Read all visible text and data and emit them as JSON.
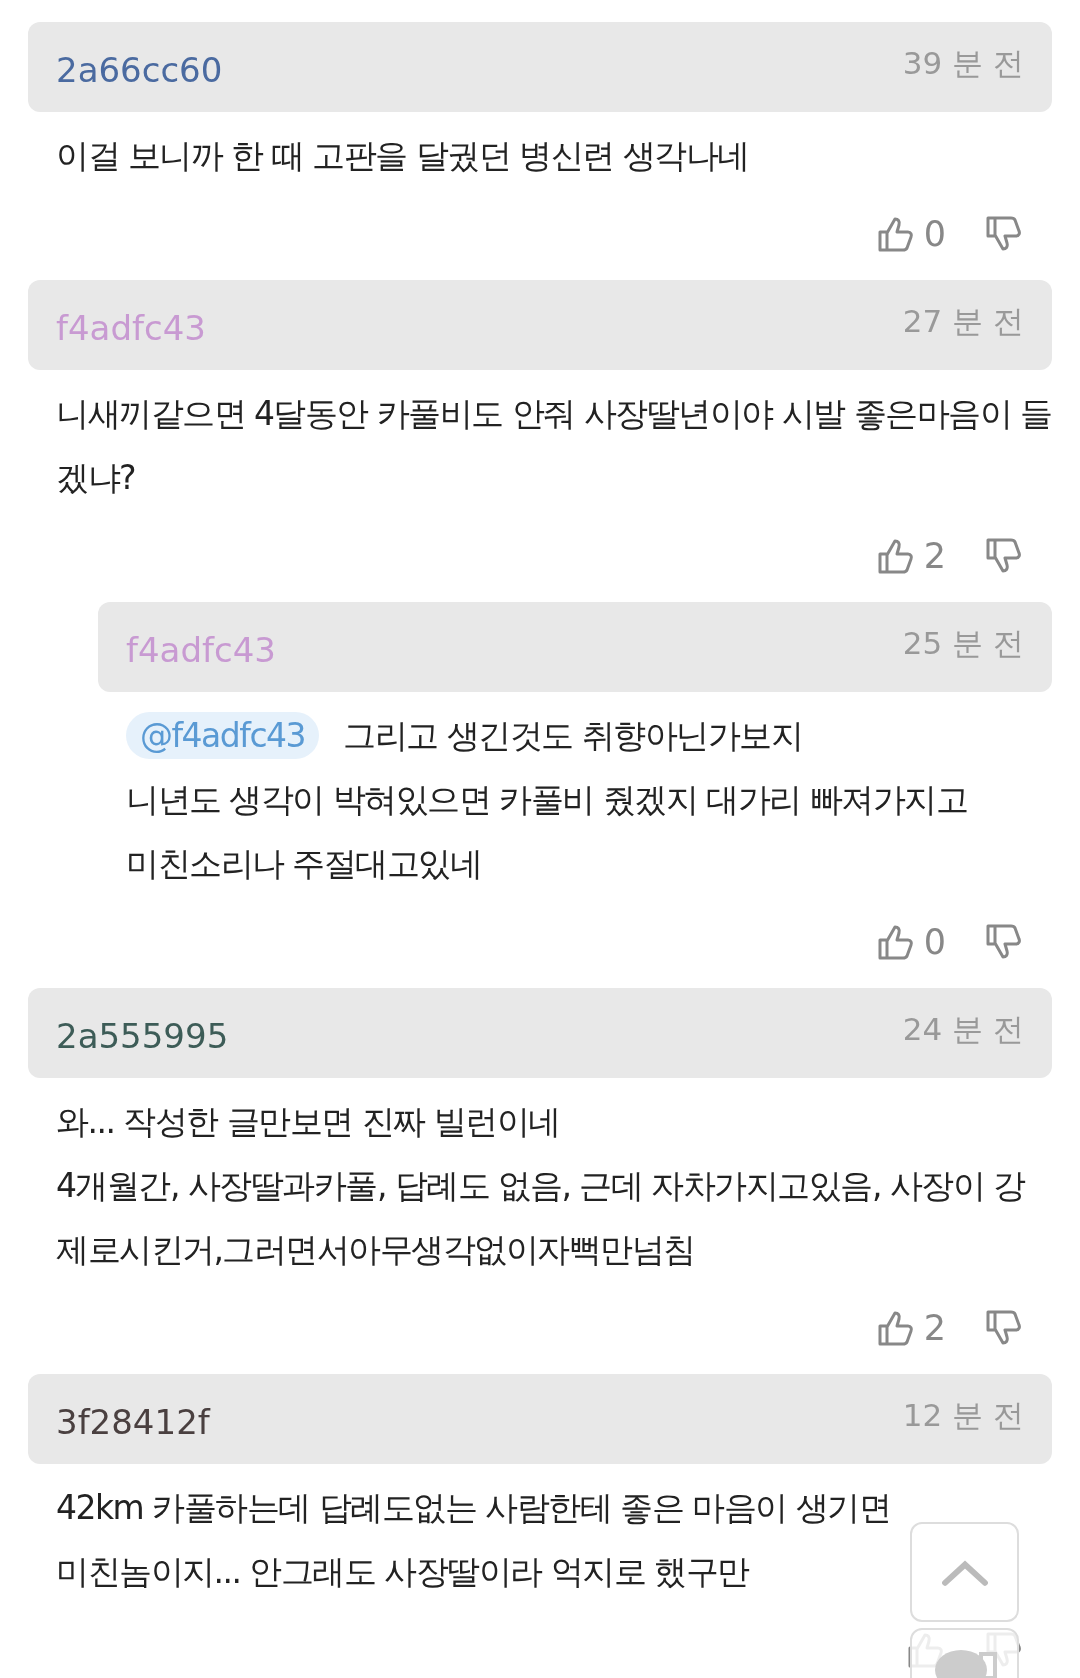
{
  "comments": [
    {
      "author": "2a66cc60",
      "color": "#4a6aa0",
      "time": "39 분 전",
      "lines": [
        "이걸 보니까 한 때 고판을 달궜던 병신련 생각나네"
      ],
      "likes": "0"
    },
    {
      "author": "f4adfc43",
      "color": "#c89ad2",
      "time": "27 분 전",
      "lines": [
        "니새끼같으면 4달동안 카풀비도 안줘 사장딸년이야 시발 좋은마음이 들겠냐?"
      ],
      "likes": "2",
      "children": [
        {
          "author": "f4adfc43",
          "color": "#c89ad2",
          "time": "25 분 전",
          "mention": "@f4adfc43",
          "lines": [
            "그리고 생긴것도 취향아닌가보지",
            "니년도 생각이 박혀있으면 카풀비 줬겠지 대가리 빠져가지고",
            "미친소리나 주절대고있네"
          ],
          "likes": "0"
        }
      ]
    },
    {
      "author": "2a555995",
      "color": "#3d5c57",
      "time": "24 분 전",
      "lines": [
        "와... 작성한 글만보면 진짜 빌런이네",
        "4개월간, 사장딸과카풀, 답례도 없음, 근데 자차가지고있음, 사장이 강제로시킨거,그러면서아무생각없이자뻑만넘침"
      ],
      "likes": "2"
    },
    {
      "author": "3f28412f",
      "color": "#4a4040",
      "time": "12 분 전",
      "lines": [
        "42km 카풀하는데 답례도없는 사람한테 좋은 마음이 생기면 미친놈이지... 안그래도 사장딸이라 억지로 했구만"
      ]
    }
  ]
}
